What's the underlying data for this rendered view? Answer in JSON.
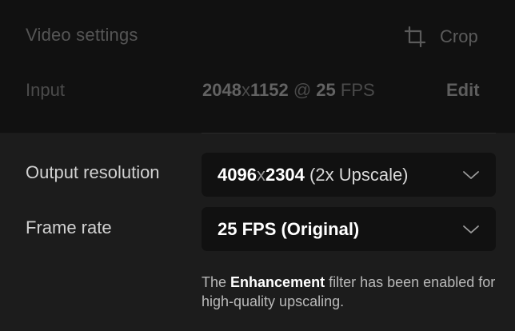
{
  "header": {
    "title": "Video settings",
    "crop_label": "Crop"
  },
  "input": {
    "label": "Input",
    "width": "2048",
    "height": "1152",
    "times": "x",
    "at": "@",
    "fps": "25",
    "fps_unit": "FPS",
    "edit_label": "Edit"
  },
  "output_resolution": {
    "label": "Output resolution",
    "width": "4096",
    "height": "2304",
    "times": "x",
    "note": "(2x Upscale)"
  },
  "frame_rate": {
    "label": "Frame rate",
    "value": "25 FPS (Original)"
  },
  "info": {
    "prefix": "The",
    "emphasis": "Enhancement",
    "suffix": "filter has been enabled for high-quality upscaling."
  }
}
